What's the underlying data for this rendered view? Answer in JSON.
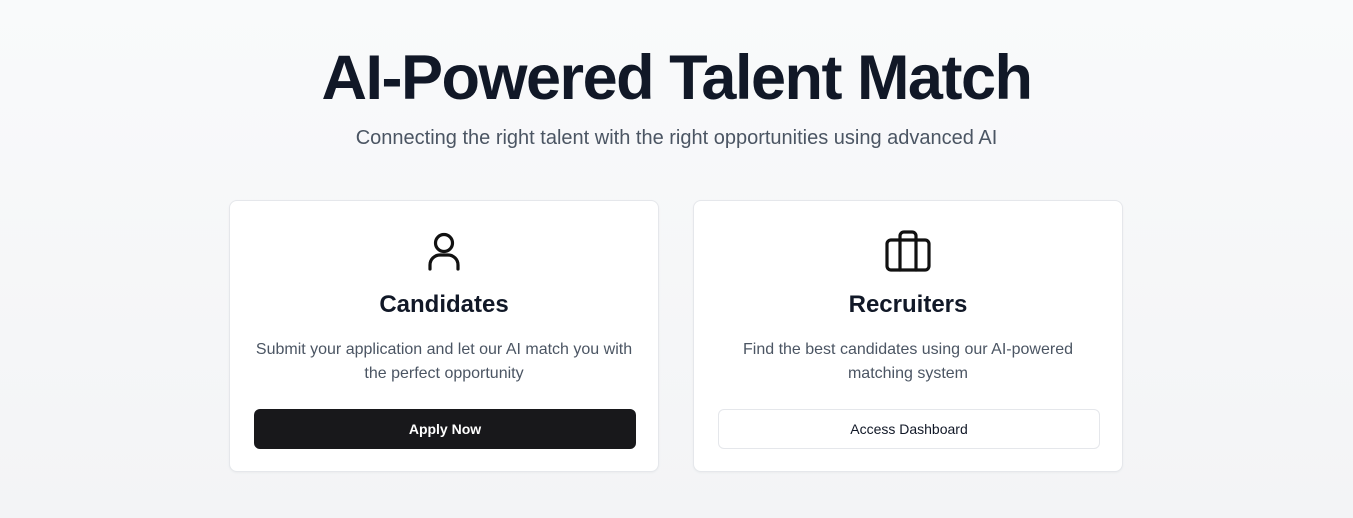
{
  "hero": {
    "title": "AI-Powered Talent Match",
    "subtitle": "Connecting the right talent with the right opportunities using advanced AI"
  },
  "cards": [
    {
      "icon": "user-icon",
      "title": "Candidates",
      "description": "Submit your application and let our AI match you with the perfect opportunity",
      "button_label": "Apply Now"
    },
    {
      "icon": "briefcase-icon",
      "title": "Recruiters",
      "description": "Find the best candidates using our AI-powered matching system",
      "button_label": "Access Dashboard"
    }
  ],
  "colors": {
    "heading": "#111827",
    "body_text": "#4b5563",
    "primary_button": "#18181b",
    "card_border": "#e5e7eb",
    "background": "#f9fafb"
  }
}
